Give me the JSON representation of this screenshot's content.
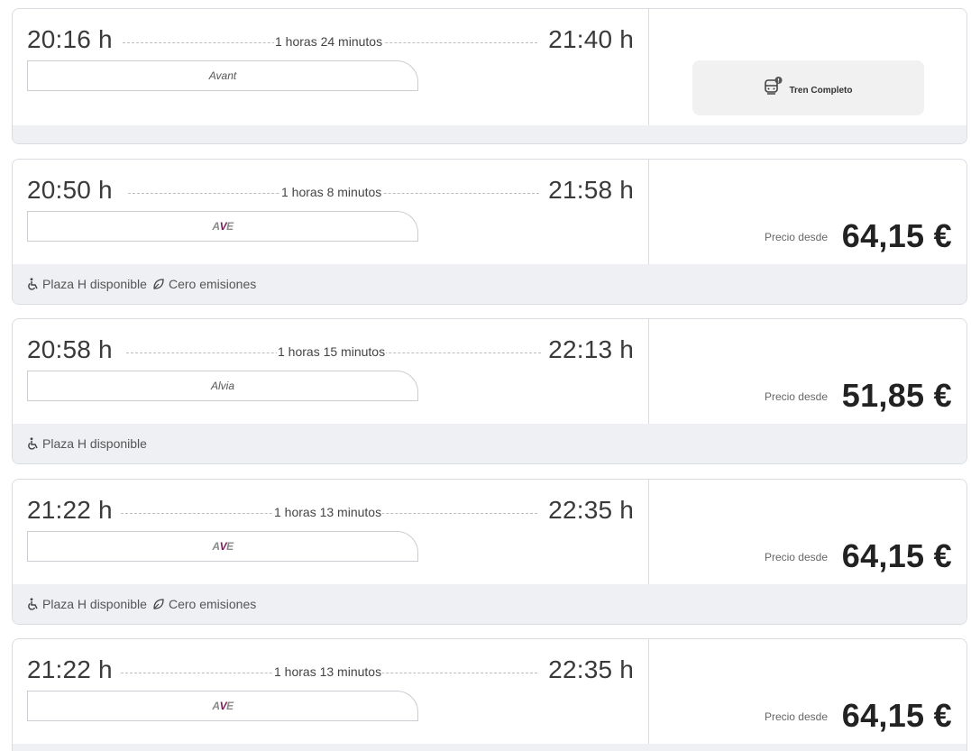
{
  "trips": [
    {
      "departure": "20:16 h",
      "arrival": "21:40 h",
      "duration": "1 horas 24 minutos",
      "train": "Avant",
      "status": "Tren Completo",
      "features": []
    },
    {
      "departure": "20:50 h",
      "arrival": "21:58 h",
      "duration": "1 horas 8 minutos",
      "train": "AVE",
      "price_label": "Precio desde",
      "price": "64,15 €",
      "features": [
        "Plaza H disponible",
        "Cero emisiones"
      ]
    },
    {
      "departure": "20:58 h",
      "arrival": "22:13 h",
      "duration": "1 horas 15 minutos",
      "train": "Alvia",
      "price_label": "Precio desde",
      "price": "51,85 €",
      "features": [
        "Plaza H disponible"
      ]
    },
    {
      "departure": "21:22 h",
      "arrival": "22:35 h",
      "duration": "1 horas 13 minutos",
      "train": "AVE",
      "price_label": "Precio desde",
      "price": "64,15 €",
      "features": [
        "Plaza H disponible",
        "Cero emisiones"
      ]
    },
    {
      "departure": "21:22 h",
      "arrival": "22:35 h",
      "duration": "1 horas 13 minutos",
      "train": "AVE",
      "price_label": "Precio desde",
      "price": "64,15 €",
      "features": []
    }
  ],
  "colors": {
    "ave_accent": "#7a1f5c",
    "footer_bg": "#eef0f3",
    "border": "#d9dde2"
  },
  "icons": [
    "wheelchair-icon",
    "leaf-icon",
    "train-alert-icon"
  ]
}
